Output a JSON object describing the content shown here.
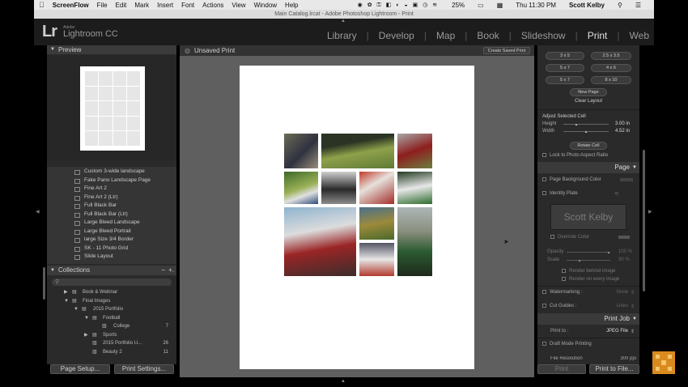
{
  "menubar": {
    "apple": "",
    "app": "ScreenFlow",
    "items": [
      "File",
      "Edit",
      "Mark",
      "Insert",
      "Font",
      "Actions",
      "View",
      "Window",
      "Help"
    ],
    "battery": "25%",
    "clock": "Thu 11:30 PM",
    "user": "Scott Kelby"
  },
  "window_title": "Main Catalog.lrcat - Adobe Photoshop Lightroom - Print",
  "logo": {
    "mark": "Lr",
    "adobe": "Adobe",
    "name": "Lightroom CC"
  },
  "modules": [
    "Library",
    "Develop",
    "Map",
    "Book",
    "Slideshow",
    "Print",
    "Web"
  ],
  "active_module": "Print",
  "left": {
    "preview_title": "Preview",
    "templates": [
      "Custom 3-wide landscape",
      "Fake Pano Landscape Page",
      "Fine Art 2",
      "Fine Art 2 (Ltr)",
      "Full Black Bar",
      "Full Black Bar (Ltr)",
      "Large Bleed Landscape",
      "Large Bleed Portrait",
      "large Size 3/4 Border",
      "SK - 11 Photo Grid",
      "Slide Layout"
    ],
    "collections_title": "Collections",
    "collections": [
      {
        "label": "Book & Webinar",
        "count": "",
        "indent": 0
      },
      {
        "label": "Final Images",
        "count": "",
        "indent": 0
      },
      {
        "label": "2015 Portfolio",
        "count": "",
        "indent": 1
      },
      {
        "label": "Football",
        "count": "",
        "indent": 2
      },
      {
        "label": "College",
        "count": "7",
        "indent": 3
      },
      {
        "label": "Sports",
        "count": "",
        "indent": 2
      },
      {
        "label": "2015 Portfolio U...",
        "count": "26",
        "indent": 2
      },
      {
        "label": "Beauty 2",
        "count": "11",
        "indent": 2
      }
    ],
    "page_setup": "Page Setup...",
    "print_settings": "Print Settings..."
  },
  "center": {
    "title": "Unsaved Print",
    "create_saved": "Create Saved Print"
  },
  "right": {
    "page_buttons": [
      "3 x 5",
      "2.5 x 3.5",
      "5 x 7",
      "4 x 6",
      "5 x 7",
      "8 x 10"
    ],
    "new_page": "New Page",
    "clear_layout": "Clear Layout",
    "adjust_cell": "Adjust Selected Cell",
    "height_label": "Height",
    "height_value": "3.00 in",
    "width_label": "Width",
    "width_value": "4.52 in",
    "rotate_cell": "Rotate Cell",
    "lock_aspect": "Lock to Photo Aspect Ratio",
    "page_title": "Page",
    "page_bg": "Page Background Color",
    "identity_plate": "Identity Plate",
    "identity_text": "Scott Kelby",
    "override_color": "Override Color",
    "opacity": "Opacity",
    "opacity_value": "100 %",
    "scale": "Scale",
    "scale_value": "30 %",
    "render_behind": "Render behind image",
    "render_every": "Render on every image",
    "watermarking": "Watermarking :",
    "watermarking_value": "None",
    "cut_guides": "Cut Guides :",
    "cut_guides_value": "Lines",
    "print_job_title": "Print Job",
    "print_to": "Print to :",
    "print_to_value": "JPEG File",
    "draft_mode": "Draft Mode Printing",
    "file_resolution": "File Resolution",
    "file_resolution_value": "300 ppi",
    "print_btn": "Print",
    "print_to_file_btn": "Print to File..."
  }
}
